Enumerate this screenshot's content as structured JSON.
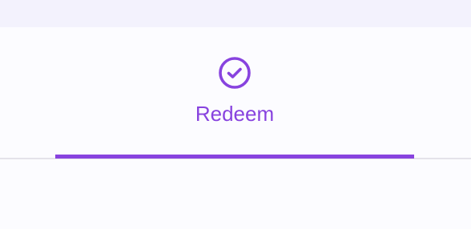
{
  "tab": {
    "label": "Redeem",
    "icon": "check-circle-icon",
    "selected": true
  },
  "colors": {
    "accent": "#8843df",
    "top_band": "#f3f2fd",
    "background": "#fcfcff",
    "divider": "#e4e3ea"
  }
}
